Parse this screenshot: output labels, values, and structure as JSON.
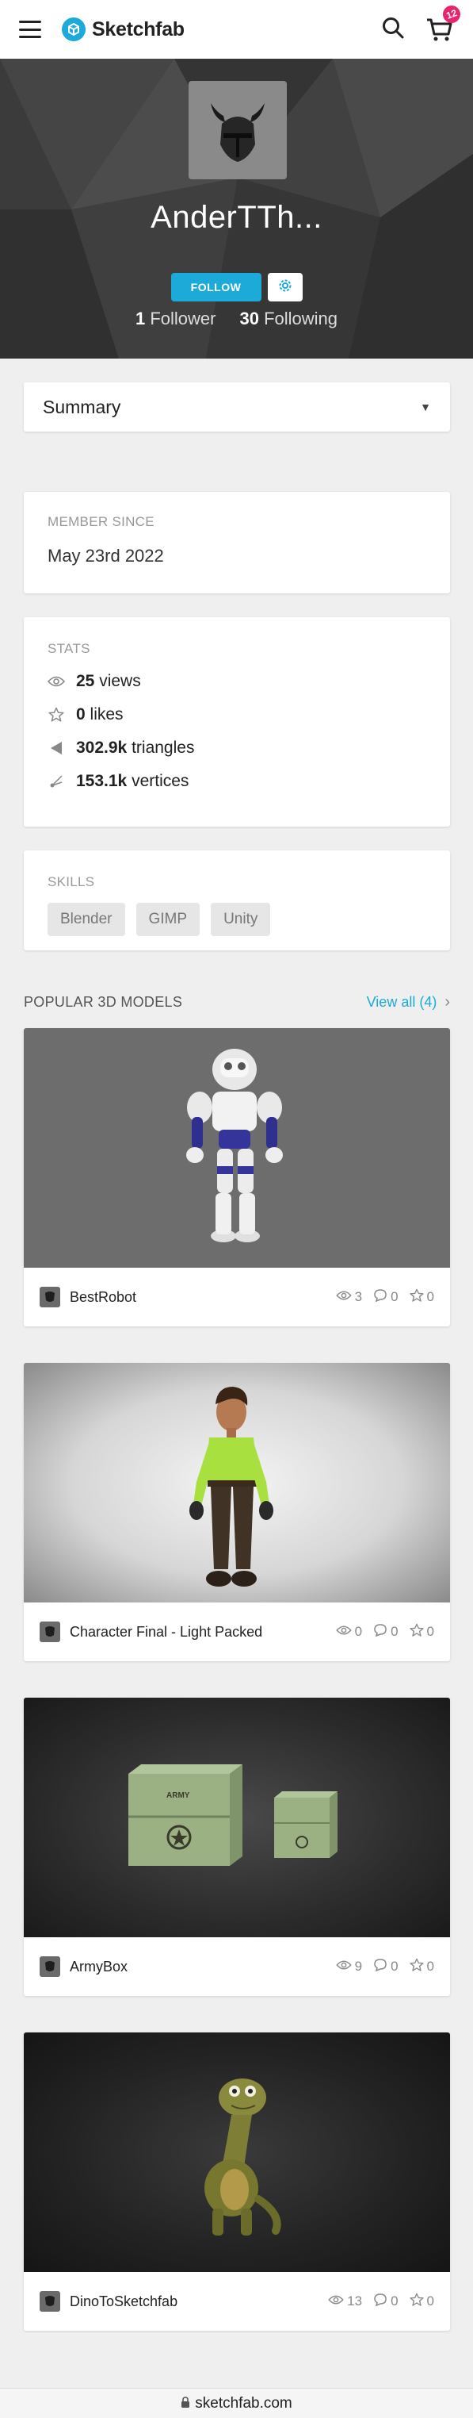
{
  "topbar": {
    "brand": "Sketchfab",
    "cart_count": "12",
    "icons": [
      "menu-icon",
      "sketchfab-logo-icon",
      "search-icon",
      "cart-icon"
    ]
  },
  "profile": {
    "username": "AnderTTh...",
    "follow_label": "FOLLOW",
    "followers_count": "1",
    "followers_label": "Follower",
    "following_count": "30",
    "following_label": "Following"
  },
  "section_select": {
    "value": "Summary"
  },
  "member": {
    "label": "MEMBER SINCE",
    "value": "May 23rd 2022"
  },
  "stats": {
    "label": "STATS",
    "items": [
      {
        "icon": "eye-icon",
        "value": "25",
        "unit": "views"
      },
      {
        "icon": "star-icon",
        "value": "0",
        "unit": "likes"
      },
      {
        "icon": "triangle-icon",
        "value": "302.9k",
        "unit": "triangles"
      },
      {
        "icon": "vertex-icon",
        "value": "153.1k",
        "unit": "vertices"
      }
    ]
  },
  "skills": {
    "label": "SKILLS",
    "items": [
      "Blender",
      "GIMP",
      "Unity"
    ]
  },
  "popular": {
    "title": "POPULAR 3D MODELS",
    "view_all": "View all (4)",
    "models": [
      {
        "name": "BestRobot",
        "views": "3",
        "comments": "0",
        "likes": "0"
      },
      {
        "name": "Character Final - Light Packed",
        "views": "0",
        "comments": "0",
        "likes": "0"
      },
      {
        "name": "ArmyBox",
        "views": "9",
        "comments": "0",
        "likes": "0"
      },
      {
        "name": "DinoToSketchfab",
        "views": "13",
        "comments": "0",
        "likes": "0"
      }
    ]
  },
  "urlbar": {
    "url": "sketchfab.com"
  },
  "colors": {
    "accent": "#1caad9",
    "badge": "#e8246f",
    "banner": "#3a3a3a"
  }
}
